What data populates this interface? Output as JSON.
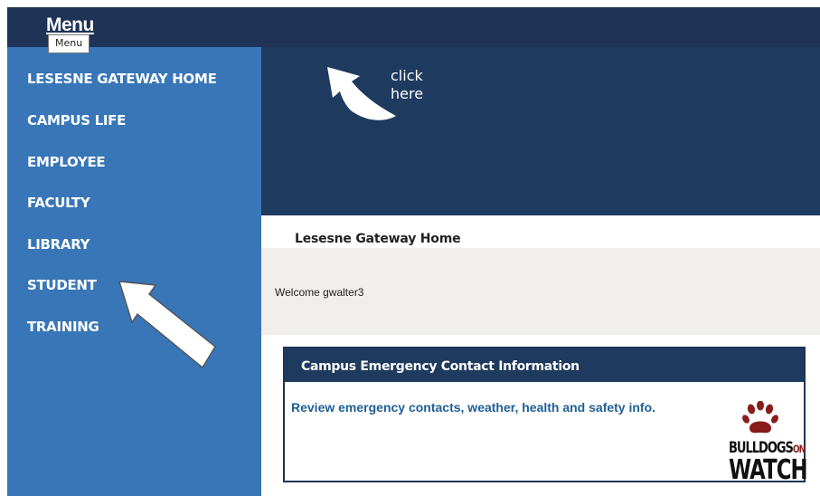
{
  "menu": {
    "title": "Menu",
    "tooltip": "Menu"
  },
  "sidebar": {
    "items": [
      {
        "label": "LESESNE GATEWAY HOME"
      },
      {
        "label": "CAMPUS LIFE"
      },
      {
        "label": "EMPLOYEE"
      },
      {
        "label": "FACULTY"
      },
      {
        "label": "LIBRARY"
      },
      {
        "label": "STUDENT"
      },
      {
        "label": "TRAINING"
      }
    ]
  },
  "hero": {
    "click_line1": "click",
    "click_line2": "here"
  },
  "main": {
    "page_title": "Lesesne Gateway Home",
    "welcome": "Welcome gwalter3"
  },
  "emergency": {
    "title": "Campus Emergency Contact Information",
    "link_text": "Review emergency contacts, weather, health and safety info.",
    "logo": {
      "line1": "BULLDOGS",
      "line1_small": "ON",
      "line2": "WATCH"
    }
  },
  "colors": {
    "topbar": "#1e3356",
    "sidebar": "#3876b7",
    "hero": "#1e3a5f",
    "panel": "#f0efeb",
    "link": "#1f5f96",
    "paw": "#8a1c1c"
  },
  "icons": {
    "hero_arrow": "curved-arrow-icon",
    "overlay_arrow": "pointer-arrow-icon",
    "logo_paw": "paw-print-icon"
  }
}
